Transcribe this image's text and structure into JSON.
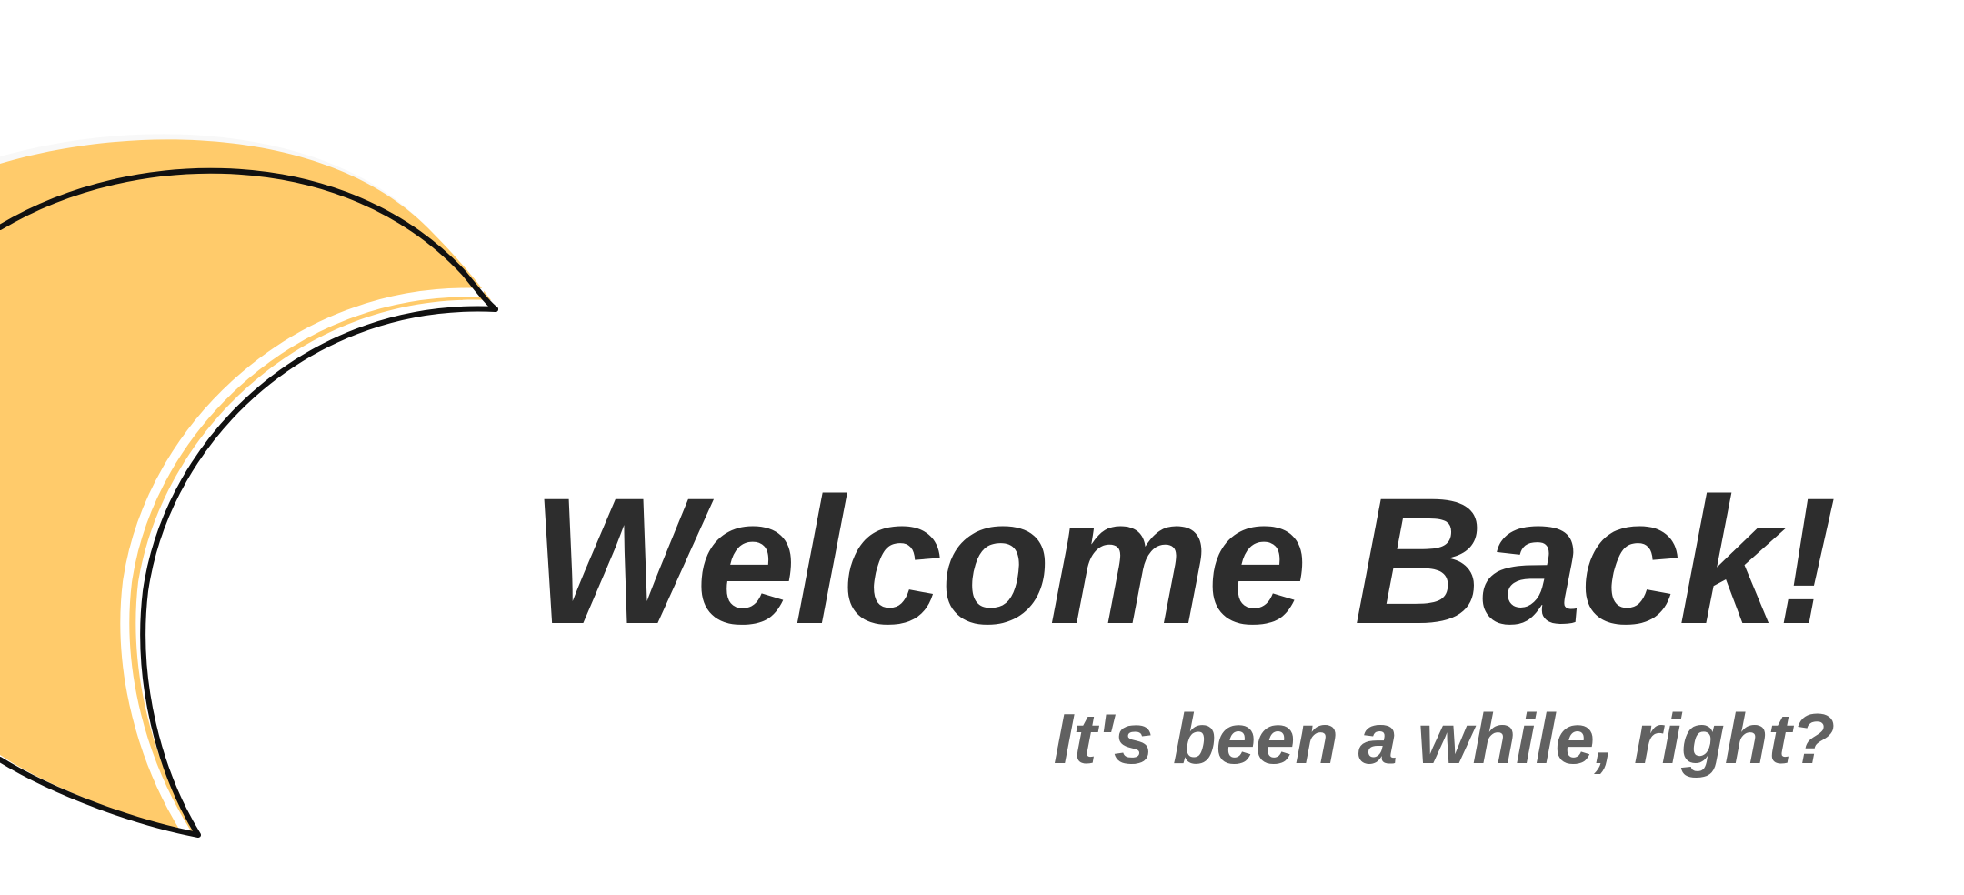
{
  "welcome": {
    "title": "Welcome Back!",
    "subtitle": "It's been a while, right?"
  },
  "illustration": {
    "icon": "crescent-moon-icon",
    "fill_color": "#FFCB6B",
    "outline_color": "#111111"
  },
  "colors": {
    "background": "#FFFFFF",
    "title_text": "#2D2D2D",
    "subtitle_text": "#616161"
  }
}
